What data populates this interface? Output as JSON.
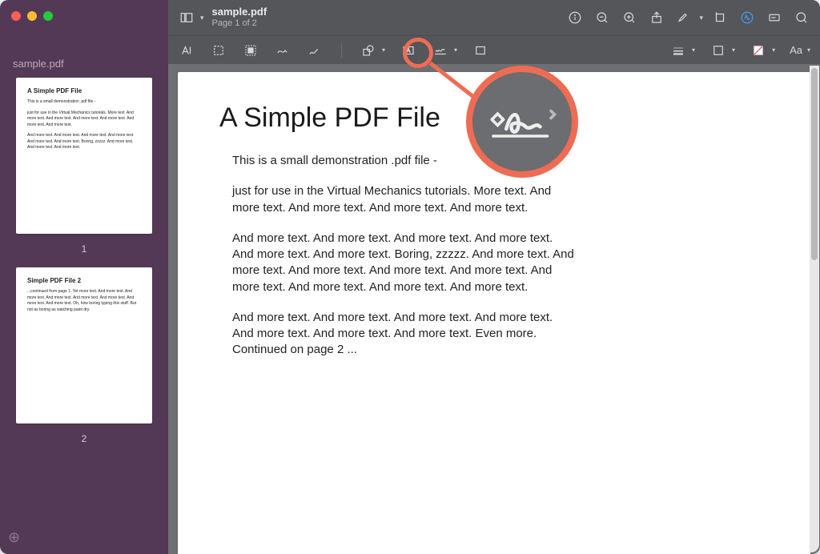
{
  "file": {
    "name": "sample.pdf",
    "page_status": "Page 1 of 2"
  },
  "thumbnails": [
    {
      "title": "A Simple PDF File",
      "num": "1"
    },
    {
      "title": "Simple PDF File 2",
      "num": "2"
    }
  ],
  "document": {
    "heading": "A Simple PDF File",
    "p1": "This is a small demonstration .pdf file -",
    "p2": "just for use in the Virtual Mechanics tutorials. More text. And more text. And more text. And more text. And more text.",
    "p3": "And more text. And more text. And more text. And more text. And more text. And more text. Boring, zzzzz. And more text. And more text. And more text. And more text. And more text. And more text. And more text. And more text. And more text.",
    "p4": "And more text. And more text. And more text. And more text. And more text. And more text. And more text. Even more. Continued on page 2 ..."
  },
  "text_tool_label": "Aa",
  "callout": {
    "tool": "signature-tool"
  }
}
